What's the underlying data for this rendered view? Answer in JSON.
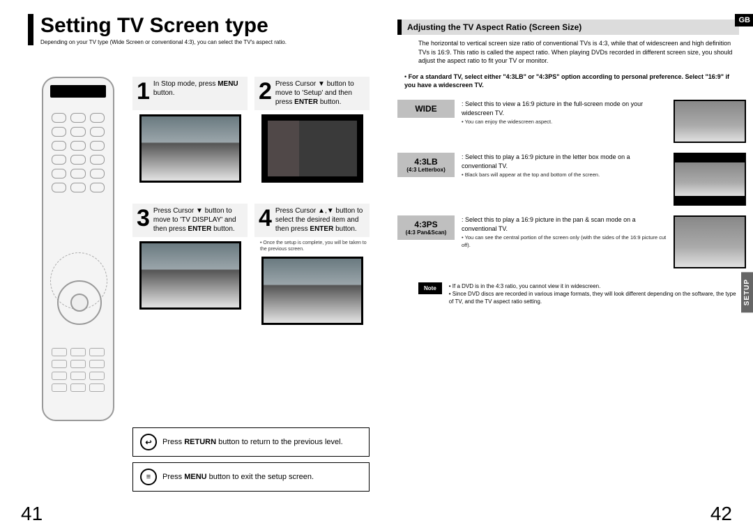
{
  "lang_tag": "GB",
  "side_tab": "SETUP",
  "page_left_num": "41",
  "page_right_num": "42",
  "title": "Setting TV Screen type",
  "subtitle": "Depending on your TV type (Wide Screen or conventional 4:3), you can select the TV's aspect ratio.",
  "steps": {
    "s1": {
      "num": "1",
      "text_a": "In Stop mode, press ",
      "bold_a": "MENU",
      "text_b": " button."
    },
    "s2": {
      "num": "2",
      "text_a": "Press Cursor ▼ button to move to 'Setup' and then press ",
      "bold_a": "ENTER",
      "text_b": " button."
    },
    "s3": {
      "num": "3",
      "text_a": "Press Cursor ▼ button to move to 'TV DISPLAY' and then press ",
      "bold_a": "ENTER",
      "text_b": " button."
    },
    "s4": {
      "num": "4",
      "text_a": "Press Cursor ▲,▼ button to select the desired item and then press ",
      "bold_a": "ENTER",
      "text_b": " button."
    },
    "s4_note": "• Once the setup is complete, you will be taken to the previous screen."
  },
  "bottom": {
    "line1_a": "Press ",
    "line1_b": "RETURN",
    "line1_c": " button to return to the previous level.",
    "line2_a": "Press ",
    "line2_b": "MENU",
    "line2_c": " button to exit the setup screen."
  },
  "right": {
    "section": "Adjusting the TV Aspect Ratio (Screen Size)",
    "intro": "The horizontal to vertical screen size ratio of conventional TVs is 4:3, while that of widescreen and high definition TVs is 16:9. This ratio is called the aspect ratio. When playing DVDs recorded in different screen size, you should adjust the aspect ratio to fit your TV or monitor.",
    "bullet1": "For a standard TV, select either \"4:3LB\" or \"4:3PS\" option according to personal preference. Select \"16:9\" if you have a widescreen TV.",
    "wide": {
      "label": "WIDE",
      "desc": ": Select this to view a 16:9 picture in the full-screen mode on your widescreen TV.",
      "sub": "• You can enjoy the widescreen aspect."
    },
    "lb": {
      "label": "4:3LB",
      "sublabel": "(4:3 Letterbox)",
      "desc": ": Select this to play a 16:9 picture in the letter box mode on a conventional TV.",
      "sub": "• Black bars will appear at the top and bottom of the screen."
    },
    "ps": {
      "label": "4:3PS",
      "sublabel": "(4:3 Pan&Scan)",
      "desc": ": Select this to play a 16:9 picture in the pan & scan mode on a conventional TV.",
      "sub": "• You can see the central portion of the screen only (with the sides of the 16:9 picture cut off)."
    },
    "note_label": "Note",
    "note1": "• If a DVD is in the 4:3 ratio, you cannot view it in widescreen.",
    "note2": "• Since DVD discs are recorded in various image formats, they will look different depending on the software, the type of TV, and the TV aspect ratio setting."
  }
}
